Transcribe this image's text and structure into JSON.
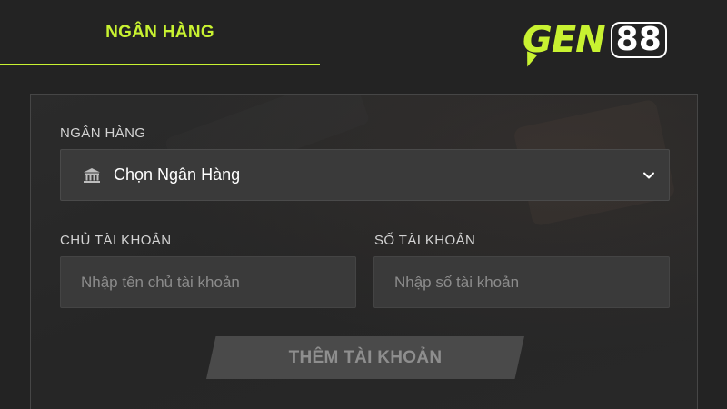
{
  "header": {
    "active_tab": "NGÂN HÀNG",
    "logo_text": "GEN",
    "logo_number": "88",
    "accent_color": "#c8f231"
  },
  "form": {
    "bank_label": "NGÂN HÀNG",
    "bank_select_value": "Chọn Ngân Hàng",
    "bank_icon": "bank-icon",
    "dropdown_icon": "chevron-down-icon",
    "account_holder_label": "CHỦ TÀI KHOẢN",
    "account_holder_placeholder": "Nhập tên chủ tài khoản",
    "account_number_label": "SỐ TÀI KHOẢN",
    "account_number_placeholder": "Nhập số tài khoản",
    "submit_label": "THÊM TÀI KHOẢN"
  }
}
